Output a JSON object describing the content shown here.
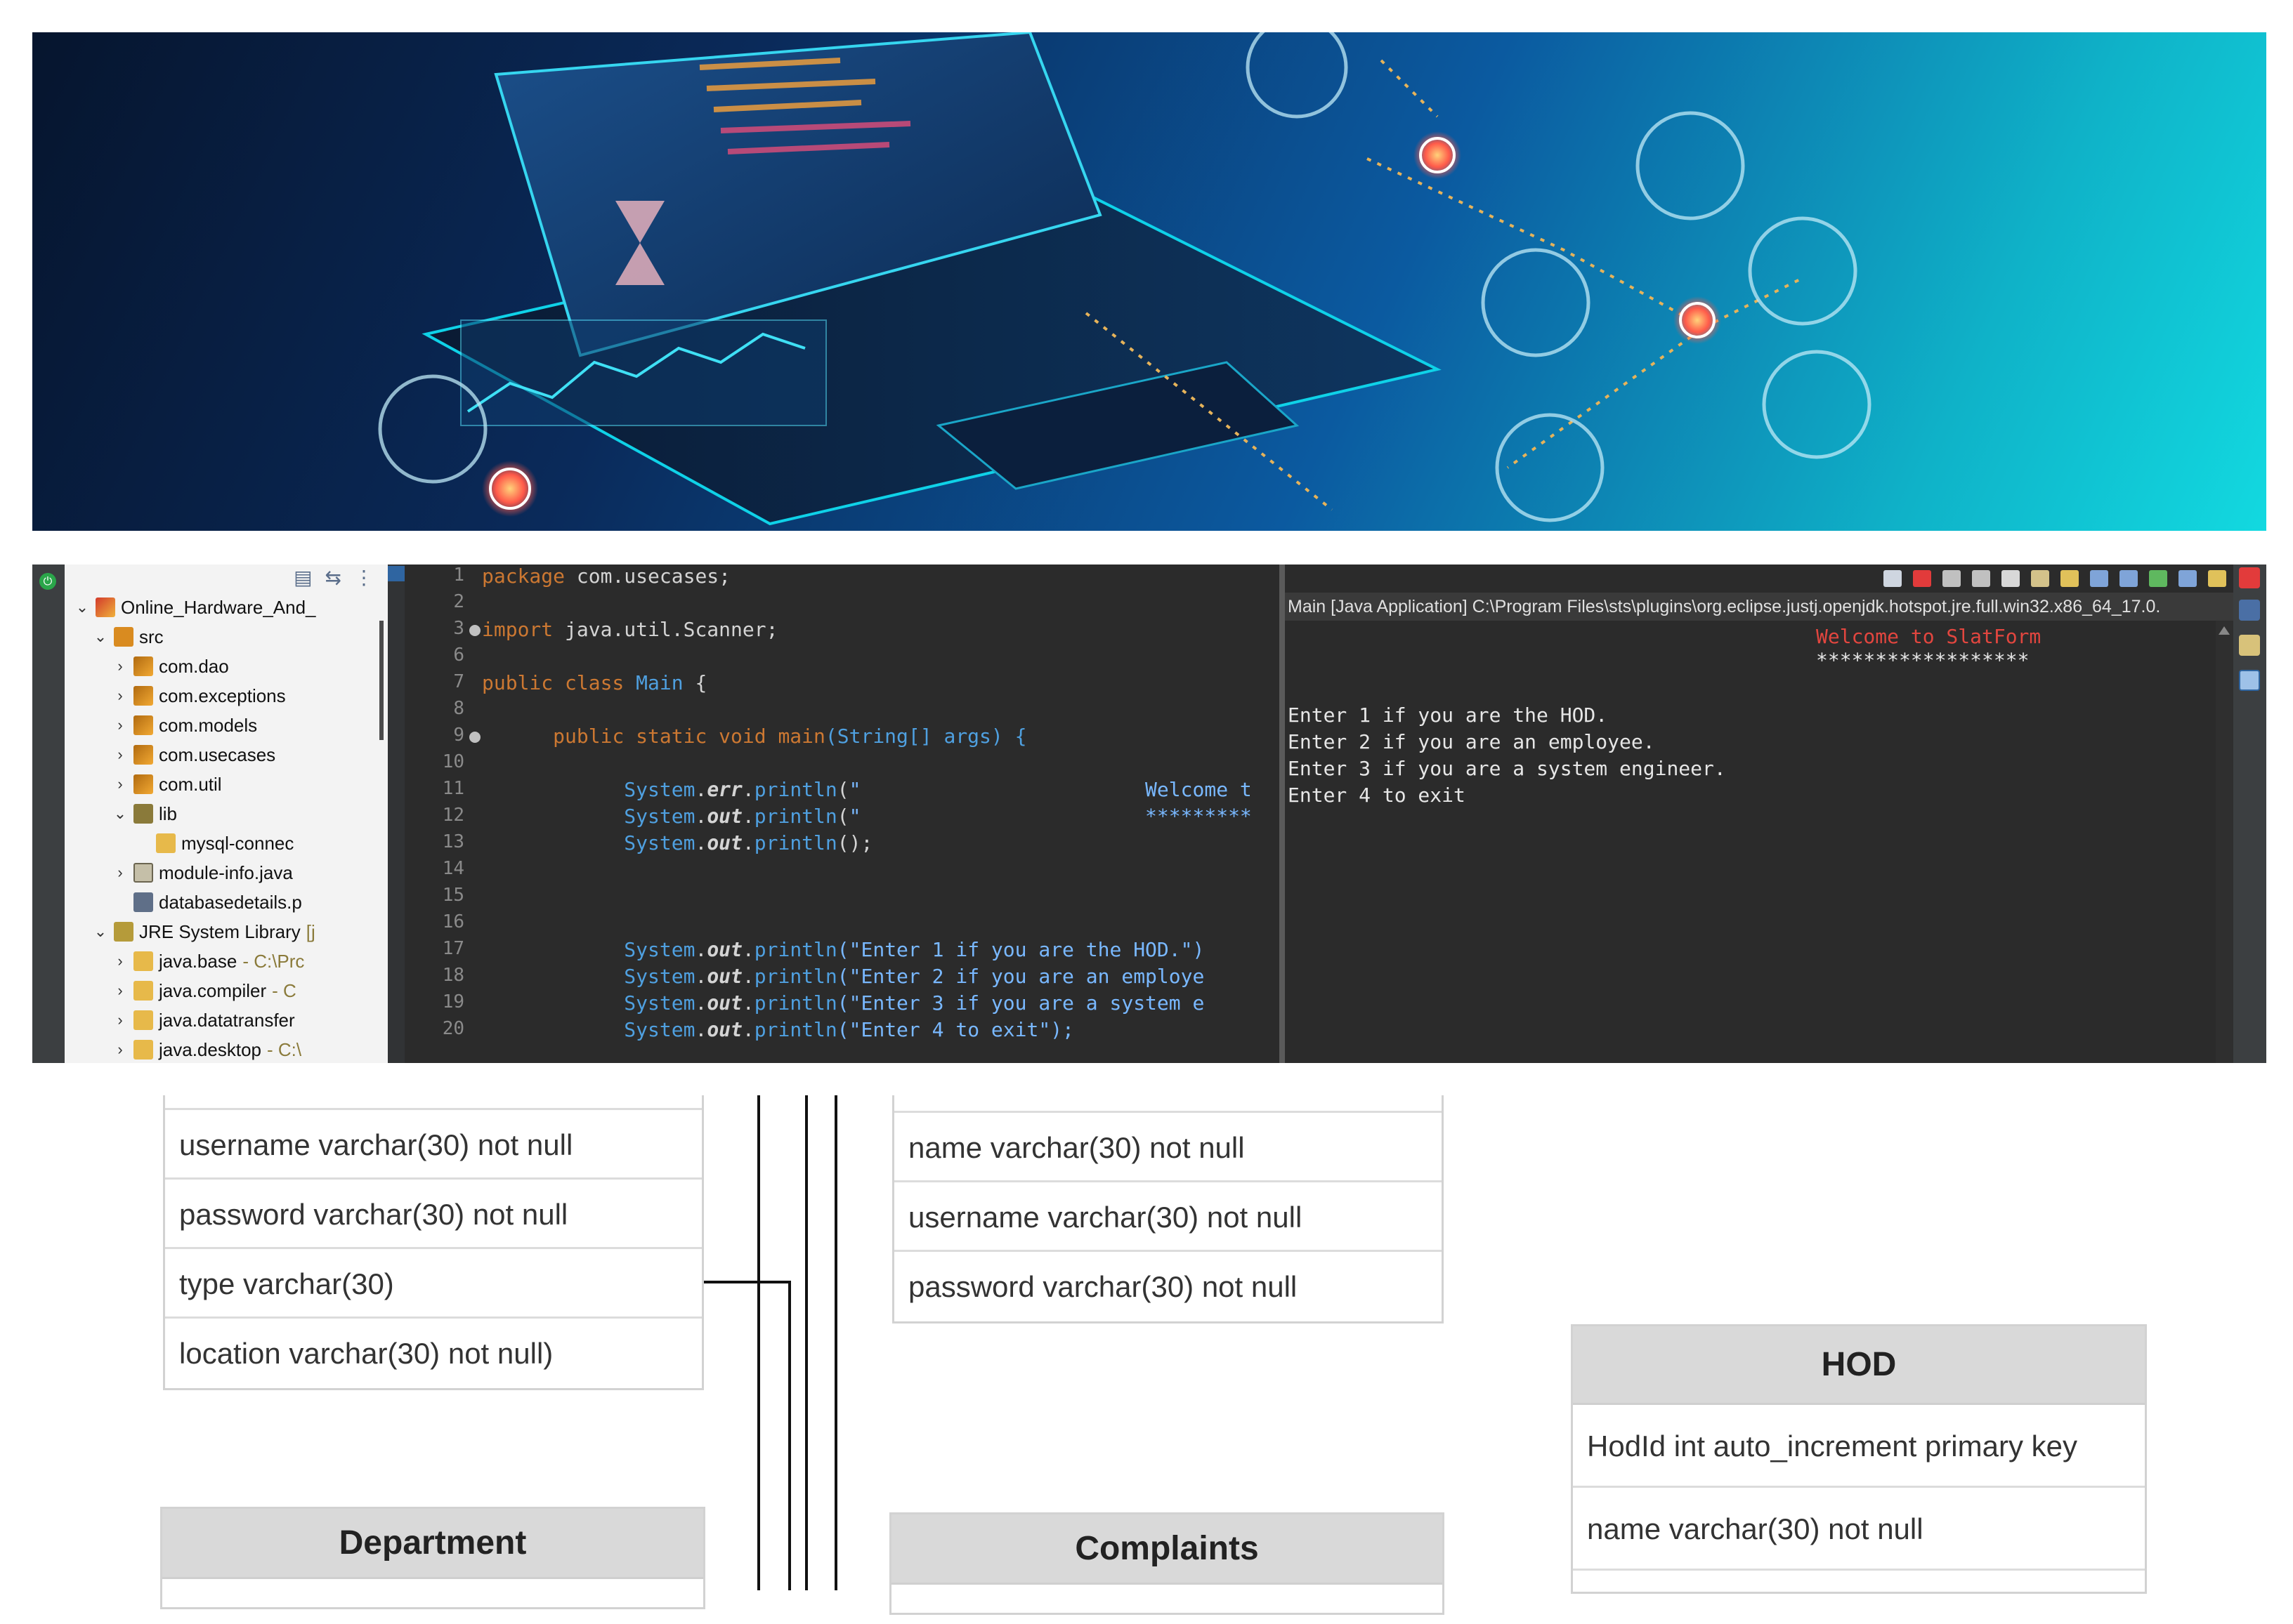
{
  "ide": {
    "explorer": {
      "project": "Online_Hardware_And_",
      "src": "src",
      "packages": [
        "com.dao",
        "com.exceptions",
        "com.models",
        "com.usecases",
        "com.util"
      ],
      "lib": "lib",
      "lib_jar": "mysql-connec",
      "module_info": "module-info.java",
      "db_file": "databasedetails.p",
      "jre": "JRE System Library",
      "jre_suffix": "[j",
      "jre_modules": [
        {
          "name": "java.base",
          "suffix": " - C:\\Prc"
        },
        {
          "name": "java.compiler",
          "suffix": " - C"
        },
        {
          "name": "java.datatransfer",
          "suffix": ""
        },
        {
          "name": "java.desktop",
          "suffix": " - C:\\"
        }
      ]
    },
    "editor": {
      "line_numbers": [
        "1",
        "2",
        "3",
        "6",
        "7",
        "8",
        "9",
        "10",
        "11",
        "12",
        "13",
        "14",
        "15",
        "16",
        "17",
        "18",
        "19",
        "20"
      ],
      "pkg_kw": "package",
      "pkg_name": "com.usecases;",
      "import_kw": "import",
      "import_name": "java.util.Scanner;",
      "class_decl_kw": "public class",
      "class_name": "Main",
      "brace_open": "{",
      "method_kw": "public static void",
      "method_name": "main",
      "method_params": "(String[] args) {",
      "sys": "System",
      "err": "err",
      "out": "out",
      "println": "println",
      "l11_str": "\"                        Welcome t",
      "l12_str": "\"                        *********",
      "l13_tail": "();",
      "l16_str": "(\"Enter 1 if you are the HOD.\")",
      "l17_str": "(\"Enter 2 if you are an employe",
      "l18_str": "(\"Enter 3 if you are a system e",
      "l19_str": "(\"Enter 4 to exit\");"
    },
    "console": {
      "title": "Main [Java Application] C:\\Program Files\\sts\\plugins\\org.eclipse.justj.openjdk.hotspot.jre.full.win32.x86_64_17.0.",
      "welcome": "Welcome to SlatForm",
      "stars": "******************",
      "lines": [
        "Enter 1 if you are the HOD.",
        "Enter 2 if you are an employee.",
        "Enter 3 if you are a system engineer.",
        "Enter 4 to exit"
      ]
    }
  },
  "er": {
    "left_fields": [
      "username varchar(30) not null",
      "password varchar(30) not null",
      "type varchar(30)",
      "location varchar(30) not null)"
    ],
    "middle_fields": [
      "name varchar(30) not null",
      "username varchar(30) not null",
      "password varchar(30) not null"
    ],
    "hod": {
      "title": "HOD",
      "fields": [
        "HodId int auto_increment primary key",
        "name varchar(30) not null"
      ]
    },
    "department_title": "Department",
    "complaints_title": "Complaints"
  },
  "colors": {
    "ide_bg": "#2b2b2b",
    "keyword": "#cc7832",
    "string_blue": "#79b8ff",
    "console_red": "#e2463f",
    "table_header": "#d9d9d9"
  }
}
